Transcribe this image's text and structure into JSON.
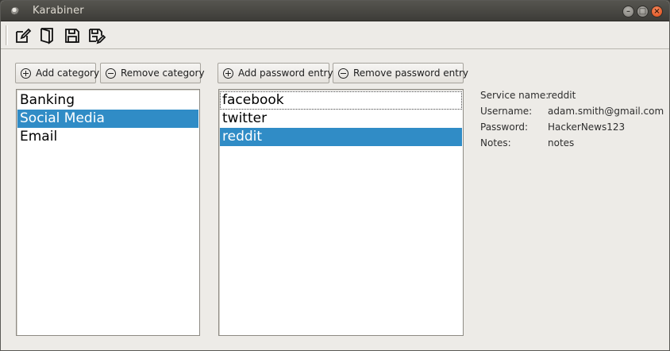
{
  "window": {
    "title": "Karabiner"
  },
  "toolbar": {
    "items": [
      {
        "icon": "edit-icon"
      },
      {
        "icon": "open-icon"
      },
      {
        "icon": "save-icon"
      },
      {
        "icon": "save-as-icon"
      }
    ]
  },
  "categories": {
    "add_label": "Add category",
    "remove_label": "Remove category",
    "items": [
      "Banking",
      "Social Media",
      "Email"
    ],
    "selected": "Social Media"
  },
  "entries": {
    "add_label": "Add password entry",
    "remove_label": "Remove password entry",
    "items": [
      "facebook",
      "twitter",
      "reddit"
    ],
    "selected": "reddit"
  },
  "details": {
    "service_label": "Service name:",
    "service_value": "reddit",
    "username_label": "Username:",
    "username_value": "adam.smith@gmail.com",
    "password_label": "Password:",
    "password_value": "HackerNews123",
    "notes_label": "Notes:",
    "notes_value": "notes"
  },
  "colors": {
    "selection": "#308cc6",
    "close_button": "#dd4814",
    "titlebar": "#3c3b37"
  }
}
